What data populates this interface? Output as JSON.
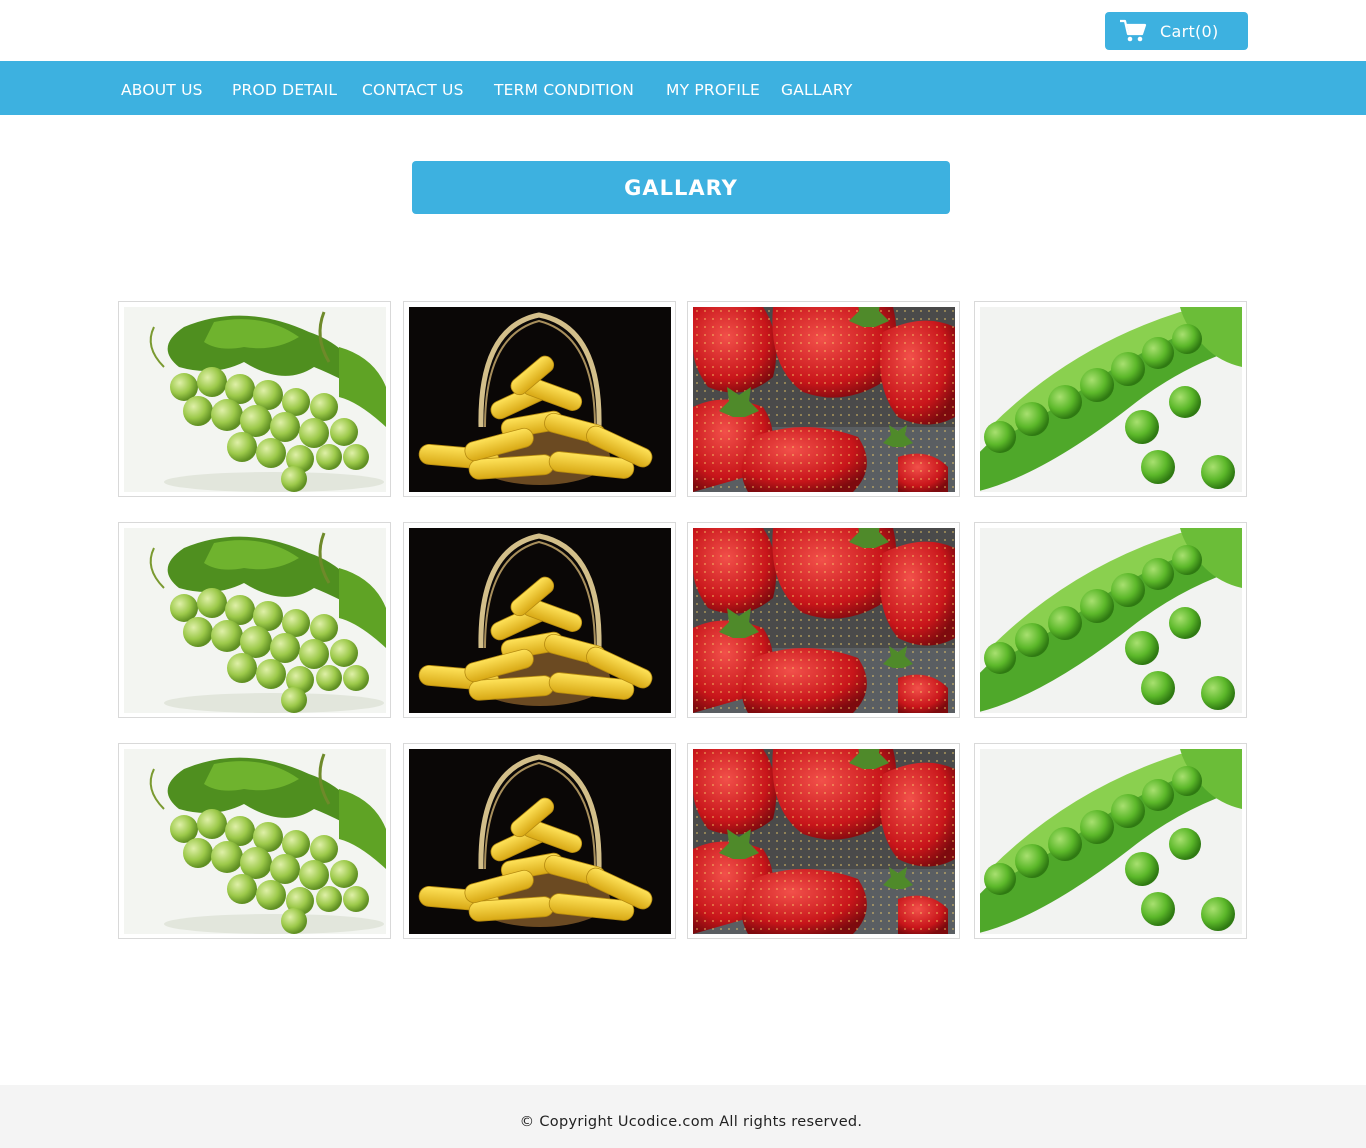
{
  "header": {
    "cart": {
      "label": "Cart",
      "count": "(0)",
      "icon": "cart-icon"
    }
  },
  "nav": {
    "items": [
      {
        "label": "ABOUT US"
      },
      {
        "label": "PROD DETAIL"
      },
      {
        "label": "CONTACT US"
      },
      {
        "label": "TERM CONDITION"
      },
      {
        "label": "MY PROFILE"
      },
      {
        "label": "GALLARY"
      }
    ]
  },
  "page": {
    "heading": "GALLARY"
  },
  "gallery": {
    "images": [
      "grapes",
      "corn-basket",
      "strawberries",
      "peas",
      "grapes",
      "corn-basket",
      "strawberries",
      "peas",
      "grapes",
      "corn-basket",
      "strawberries",
      "peas"
    ]
  },
  "footer": {
    "copyright": "© Copyright Ucodice.com All rights reserved."
  },
  "colors": {
    "accent": "#3db1e0",
    "footer_bg": "#f4f4f4"
  }
}
